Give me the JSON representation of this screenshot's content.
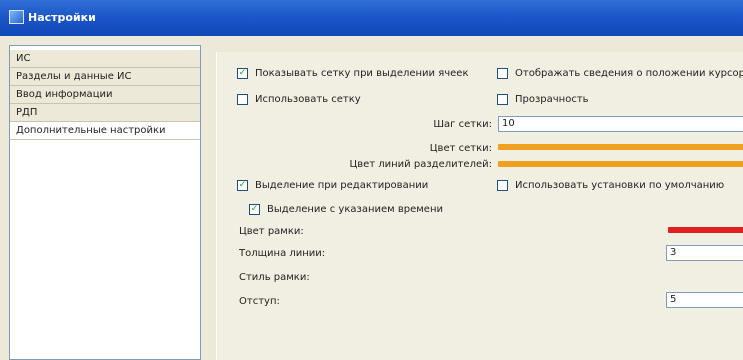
{
  "window": {
    "title": "Настройки"
  },
  "sidebar": {
    "items": [
      {
        "label": "ИС"
      },
      {
        "label": "Разделы и данные ИС"
      },
      {
        "label": "Ввод информации"
      },
      {
        "label": "РДП"
      },
      {
        "label": "Дополнительные настройки"
      }
    ]
  },
  "settings": {
    "show_grid": {
      "label": "Показывать сетку при выделении ячеек",
      "checked": true
    },
    "sync_scroll": {
      "label": "Отображать сведения о положении курсора",
      "checked": false
    },
    "use_grid": {
      "label": "Использовать сетку",
      "checked": false
    },
    "transparency": {
      "label": "Прозрачность",
      "checked": false
    },
    "step": {
      "label": "Шаг сетки:",
      "value": "10"
    },
    "grid_color": {
      "label": "Цвет сетки:",
      "color": "#f0a020"
    },
    "grid_line_color": {
      "label": "Цвет линий разделителей:",
      "color": "#f0a020"
    },
    "highlight": {
      "label": "Выделение при редактировании",
      "checked": true
    },
    "use_settings": {
      "label": "Использовать установки по умолчанию",
      "checked": false
    },
    "highlight_time": {
      "label": "Выделение с указанием времени",
      "checked": true
    },
    "line_color": {
      "label": "Цвет рамки:",
      "color": "#e02020"
    },
    "line_thickness": {
      "label": "Толщина линии:",
      "value": "3"
    },
    "line_style": {
      "label": "Стиль рамки:"
    },
    "offset": {
      "label": "Отступ:",
      "value": "5"
    }
  },
  "colors": {
    "titlebar": "#1b55c9",
    "accent": "#f0a020",
    "red": "#e02020"
  }
}
